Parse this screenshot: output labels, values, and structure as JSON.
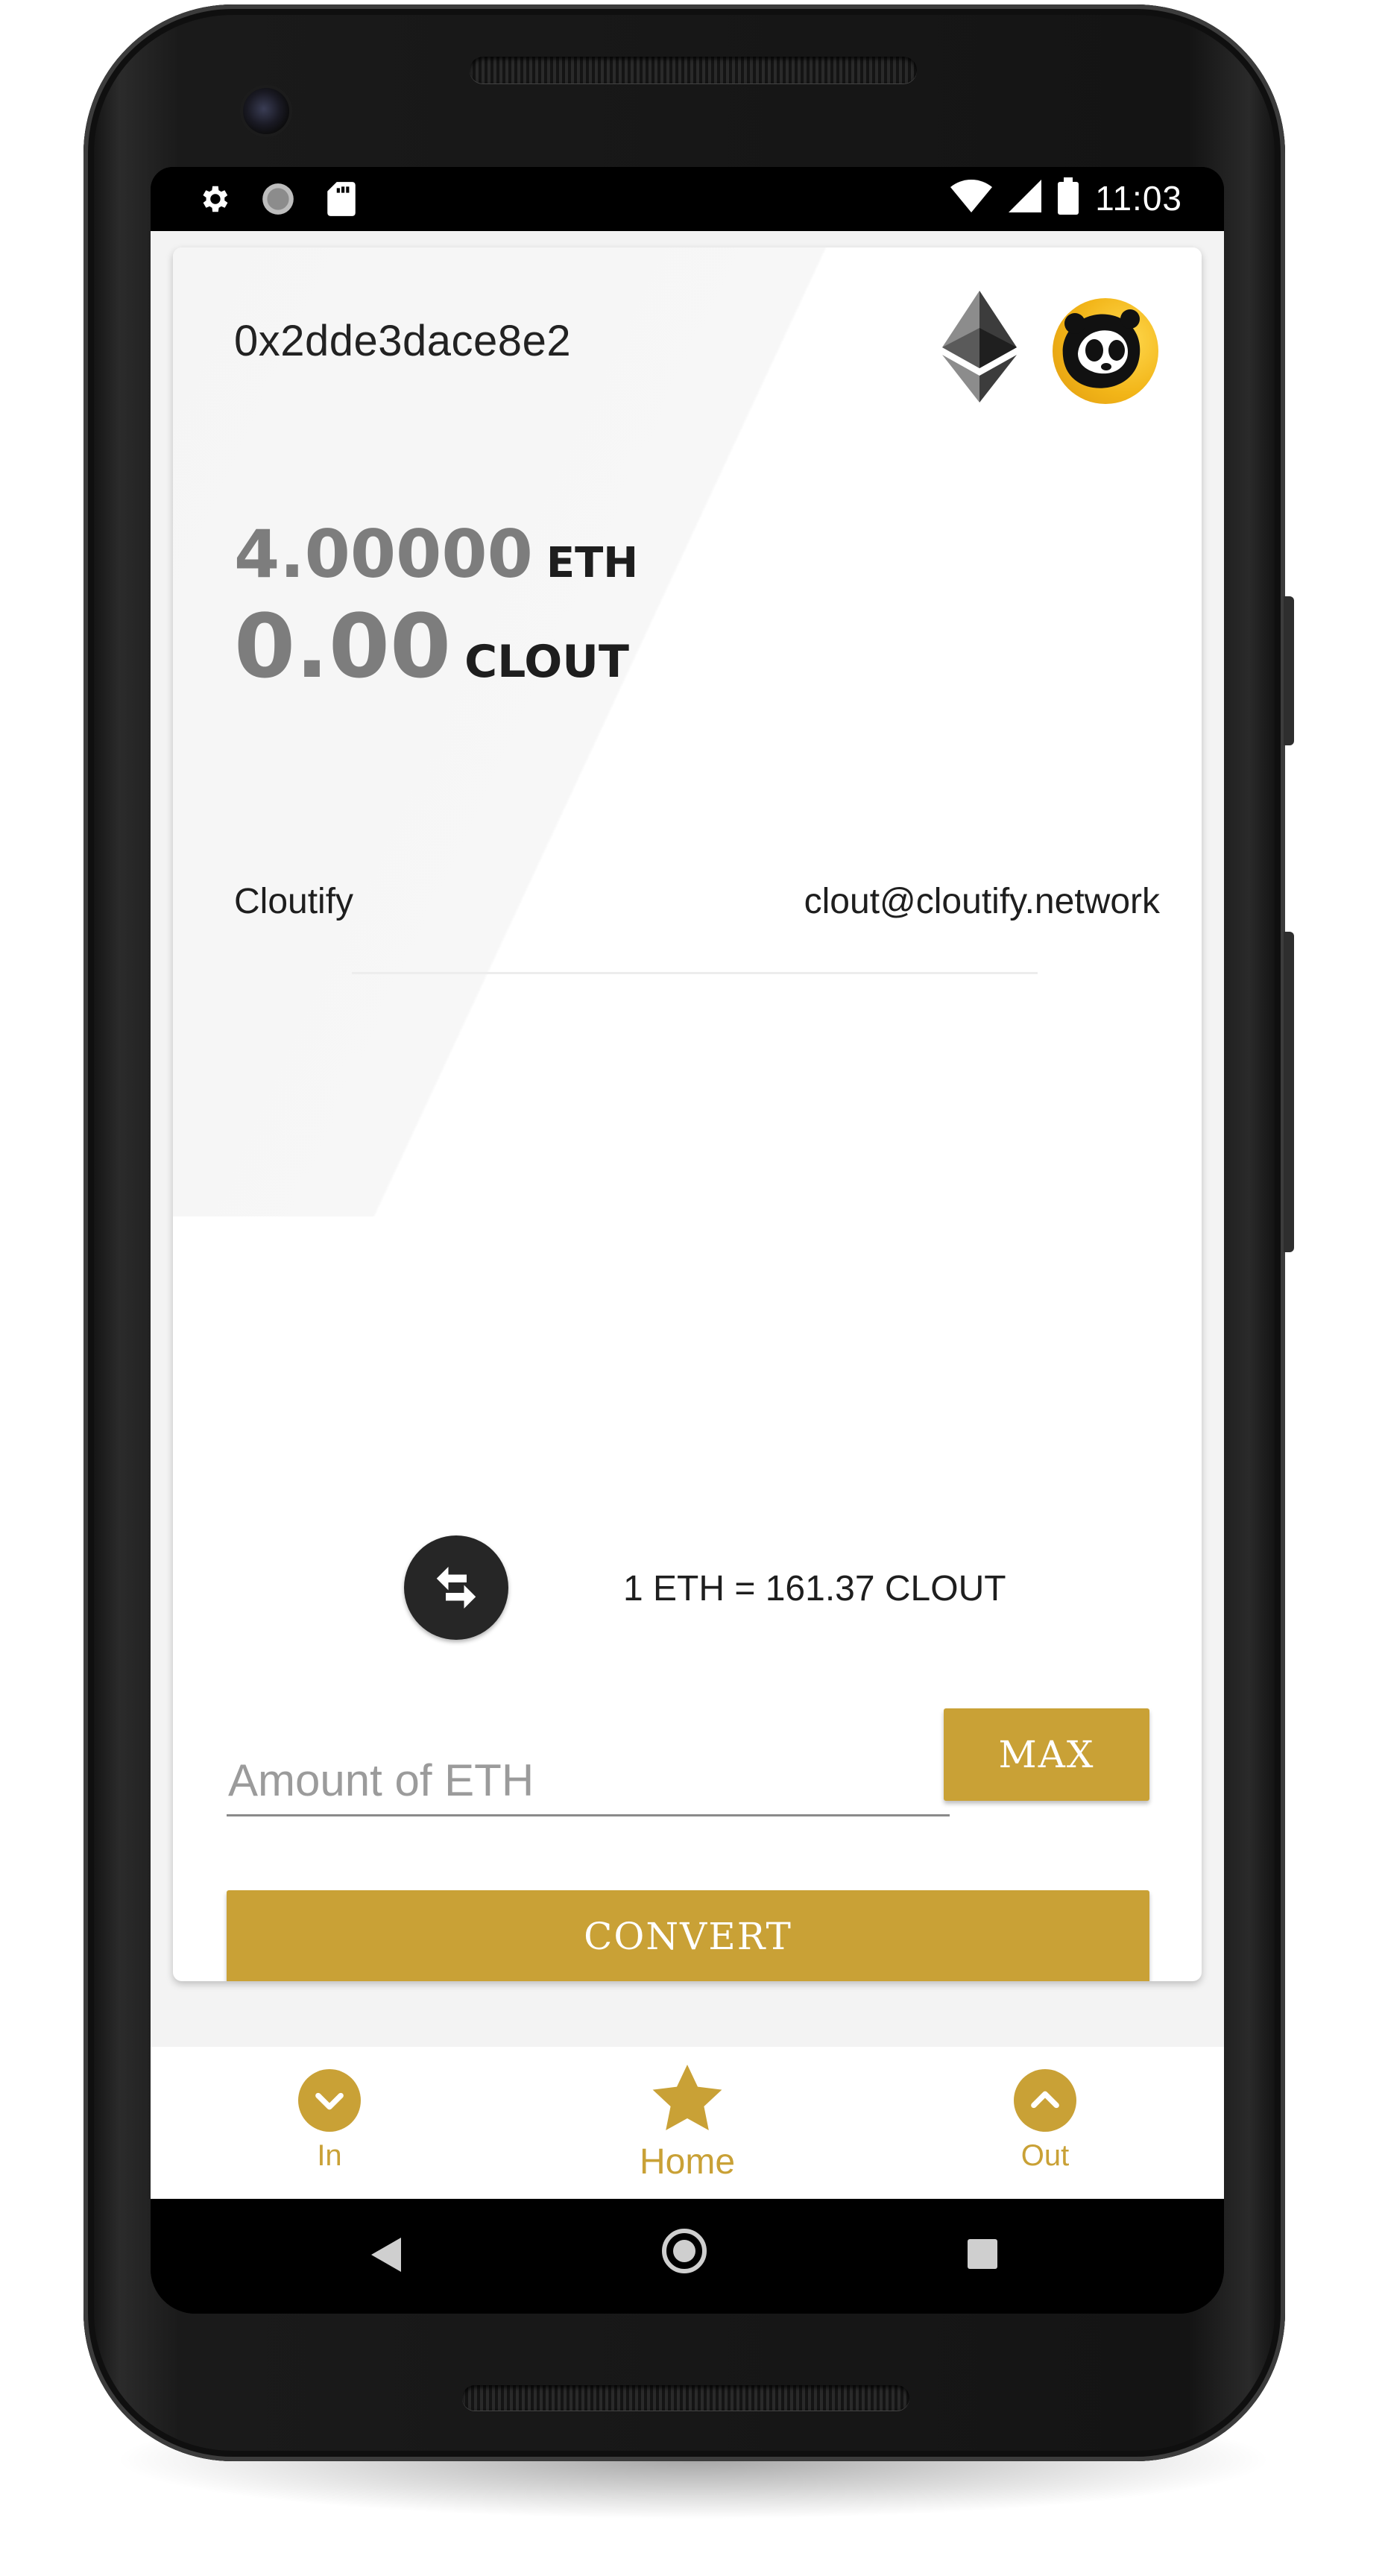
{
  "status_bar": {
    "time": "11:03",
    "left_icons": [
      "gear-icon",
      "circle-icon",
      "sd-card-icon"
    ],
    "right_icons": [
      "wifi-icon",
      "cell-signal-icon",
      "battery-icon"
    ]
  },
  "wallet": {
    "address": "0x2dde3dace8e2",
    "network_icon": "ethereum-logo",
    "avatar": "cloutify-panda-avatar"
  },
  "balances": {
    "eth_amount": "4.00000",
    "eth_unit": "ETH",
    "clout_amount": "0.00",
    "clout_unit": "CLOUT"
  },
  "company": {
    "name": "Cloutify",
    "email": "clout@cloutify.network"
  },
  "exchange": {
    "rate_text": "1 ETH = 161.37 CLOUT",
    "amount_placeholder": "Amount of ETH",
    "max_label": "MAX",
    "convert_label": "CONVERT"
  },
  "bottom_nav": {
    "items": [
      {
        "label": "In",
        "icon": "chevron-down-icon"
      },
      {
        "label": "Home",
        "icon": "star-icon",
        "active": true
      },
      {
        "label": "Out",
        "icon": "chevron-up-icon"
      }
    ]
  },
  "colors": {
    "accent": "#c9a136",
    "swap_button": "#262626",
    "balance_gray": "#7d7d7d",
    "avatar_yellow": "#f2b518"
  }
}
